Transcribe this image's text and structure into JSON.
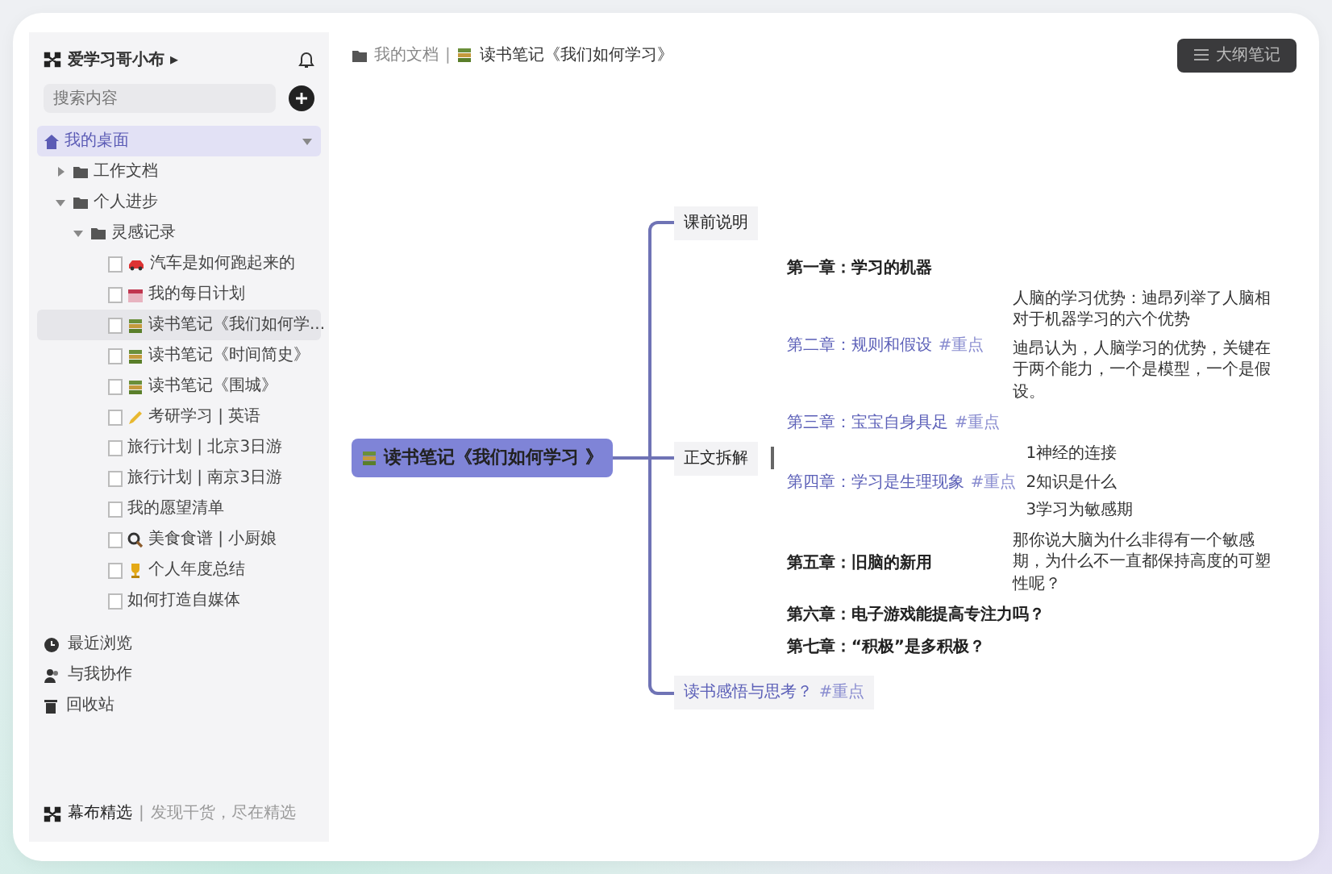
{
  "sidebar": {
    "workspace": "爱学习哥小布 ▸",
    "search": {
      "placeholder": "搜索内容"
    },
    "tree": [
      {
        "label": "我的桌面",
        "kind": "desk",
        "selected": true,
        "expanded": true,
        "children": [
          {
            "label": "工作文档",
            "kind": "folder",
            "selected": false,
            "expanded": false
          },
          {
            "label": "个人进步",
            "kind": "folder",
            "selected": false,
            "expanded": true,
            "children": [
              {
                "label": "灵感记录",
                "kind": "folder",
                "selected": false,
                "expanded": true,
                "children": [
                  {
                    "label": "汽车是如何跑起来的",
                    "kind": "car",
                    "selected": false
                  },
                  {
                    "label": "我的每日计划",
                    "kind": "calendar",
                    "selected": false
                  },
                  {
                    "label": "读书笔记《我们如何学...",
                    "kind": "book",
                    "selected": true
                  },
                  {
                    "label": "读书笔记《时间简史》",
                    "kind": "book",
                    "selected": false
                  },
                  {
                    "label": "读书笔记《围城》",
                    "kind": "book",
                    "selected": false
                  },
                  {
                    "label": "考研学习 | 英语",
                    "kind": "pencil",
                    "selected": false
                  },
                  {
                    "label": "旅行计划 | 北京3日游",
                    "kind": "plain",
                    "selected": false
                  },
                  {
                    "label": "旅行计划 | 南京3日游",
                    "kind": "plain",
                    "selected": false
                  },
                  {
                    "label": "我的愿望清单",
                    "kind": "plain",
                    "selected": false
                  },
                  {
                    "label": "美食食谱 | 小厨娘",
                    "kind": "magnifier",
                    "selected": false
                  },
                  {
                    "label": "个人年度总结",
                    "kind": "trophy",
                    "selected": false
                  },
                  {
                    "label": "如何打造自媒体",
                    "kind": "plain",
                    "selected": false
                  }
                ]
              }
            ]
          }
        ]
      }
    ],
    "links": [
      {
        "label": "最近浏览",
        "kind": "clock"
      },
      {
        "label": "与我协作",
        "kind": "people"
      },
      {
        "label": "回收站",
        "kind": "trash"
      }
    ],
    "footer": {
      "brand": "幕布精选",
      "separator": "|",
      "slogan": "发现干货，尽在精选"
    }
  },
  "breadcrumb": {
    "items": [
      {
        "label": "我的文档",
        "kind": "folder"
      },
      {
        "label": "读书笔记《我们如何学习》",
        "kind": "book"
      }
    ],
    "separator": "|"
  },
  "outline_button": "大纲笔记",
  "mindmap": {
    "root": "读书笔记《我们如何学习 》",
    "branches": [
      {
        "label": "课前说明",
        "kind": "plain",
        "focused": false
      },
      {
        "label": "正文拆解",
        "kind": "plain",
        "focused": true,
        "children": [
          {
            "label": "第一章：学习的机器",
            "kind": "plain"
          },
          {
            "label": "第二章：规则和假设",
            "kind": "linked",
            "tag": "#重点",
            "children": [
              "人脑的学习优势：迪昂列举了人脑相对于机器学习的六个优势",
              "迪昂认为，人脑学习的优势，关键在于两个能力，一个是模型，一个是假设。"
            ]
          },
          {
            "label": "第三章：宝宝自身具足",
            "kind": "linked",
            "tag": "#重点"
          },
          {
            "label": "第四章：学习是生理现象",
            "kind": "linked",
            "tag": "#重点",
            "children": [
              "1神经的连接",
              "2知识是什么",
              "3学习为敏感期"
            ]
          },
          {
            "label": "第五章：旧脑的新用",
            "kind": "plain",
            "children": [
              "那你说大脑为什么非得有一个敏感期，为什么不一直都保持高度的可塑性呢？"
            ]
          },
          {
            "label": "第六章：电子游戏能提高专注力吗？",
            "kind": "plain"
          },
          {
            "label": "第七章：“积极”是多积极？",
            "kind": "plain"
          }
        ]
      },
      {
        "label": "读书感悟与思考？",
        "kind": "linked",
        "tag": "#重点",
        "focused": false
      }
    ]
  }
}
